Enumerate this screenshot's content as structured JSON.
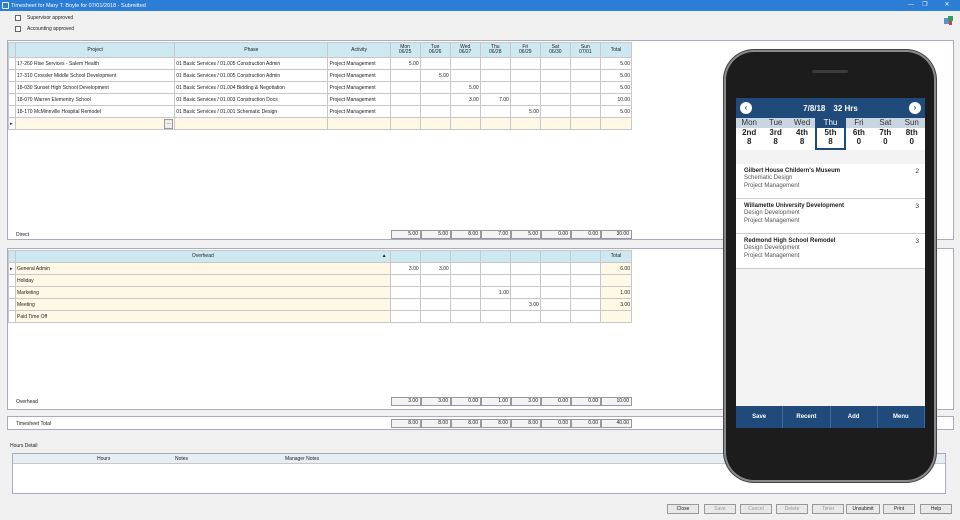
{
  "window": {
    "title": "Timesheet for Mary T. Boyle for 07/01/2018  - Submitted",
    "min": "—",
    "restore": "❐",
    "close": "✕"
  },
  "approvals": {
    "supervisor": "Supervisor approved",
    "accounting": "Accounting approved"
  },
  "direct": {
    "headers": {
      "project": "Project",
      "phase": "Phase",
      "activity": "Activity",
      "total": "Total"
    },
    "days": [
      {
        "name": "Mon",
        "date": "06/25"
      },
      {
        "name": "Tue",
        "date": "06/26"
      },
      {
        "name": "Wed",
        "date": "06/27"
      },
      {
        "name": "Thu",
        "date": "06/28"
      },
      {
        "name": "Fri",
        "date": "06/29"
      },
      {
        "name": "Sat",
        "date": "06/30"
      },
      {
        "name": "Sun",
        "date": "07/01"
      }
    ],
    "rows": [
      {
        "project": "17-260 Rise Services - Salem Health",
        "phase": "01 Basic Services / 01.005 Construction Admin",
        "activity": "Project Management",
        "hours": [
          "5.00",
          "",
          "",
          "",
          "",
          "",
          ""
        ],
        "total": "5.00"
      },
      {
        "project": "17-310 Crossler Middle School Development",
        "phase": "01 Basic Services / 01.005 Construction Admin",
        "activity": "Project Management",
        "hours": [
          "",
          "5.00",
          "",
          "",
          "",
          "",
          ""
        ],
        "total": "5.00"
      },
      {
        "project": "18-030 Sunset High School Development",
        "phase": "01 Basic Services / 01.004 Bidding & Negotiation",
        "activity": "Project Management",
        "hours": [
          "",
          "",
          "5.00",
          "",
          "",
          "",
          ""
        ],
        "total": "5.00"
      },
      {
        "project": "18-070 Warren Elementry School",
        "phase": "01 Basic Services / 01.003 Construction Docs",
        "activity": "Project Management",
        "hours": [
          "",
          "",
          "3.00",
          "7.00",
          "",
          "",
          ""
        ],
        "total": "10.00"
      },
      {
        "project": "18-170 McMinnville Hospital Remodel",
        "phase": "01 Basic Services / 01.001 Schematic Design",
        "activity": "Project Management",
        "hours": [
          "",
          "",
          "",
          "",
          "5.00",
          "",
          ""
        ],
        "total": "5.00"
      }
    ],
    "ellipsis": "···",
    "summary_label": "Direct",
    "summary": [
      "5.00",
      "5.00",
      "8.00",
      "7.00",
      "5.00",
      "0.00",
      "0.00"
    ],
    "summary_total": "30.00"
  },
  "overhead": {
    "header": "Overhead",
    "sort_icon": "▲",
    "total_header": "Total",
    "rows": [
      {
        "name": "General Admin",
        "hours": [
          "3.00",
          "3.00",
          "",
          "",
          "",
          "",
          ""
        ],
        "total": "6.00"
      },
      {
        "name": "Holiday",
        "hours": [
          "",
          "",
          "",
          "",
          "",
          "",
          ""
        ],
        "total": ""
      },
      {
        "name": "Marketing",
        "hours": [
          "",
          "",
          "",
          "1.00",
          "",
          "",
          ""
        ],
        "total": "1.00"
      },
      {
        "name": "Meeting",
        "hours": [
          "",
          "",
          "",
          "",
          "3.00",
          "",
          ""
        ],
        "total": "3.00"
      },
      {
        "name": "Paid Time Off",
        "hours": [
          "",
          "",
          "",
          "",
          "",
          "",
          ""
        ],
        "total": ""
      }
    ],
    "summary_label": "Overhead",
    "summary": [
      "3.00",
      "3.00",
      "0.00",
      "1.00",
      "3.00",
      "0.00",
      "0.00"
    ],
    "summary_total": "10.00"
  },
  "timesheet_total": {
    "label": "Timesheet Total",
    "values": [
      "8.00",
      "8.00",
      "8.00",
      "8.00",
      "8.00",
      "0.00",
      "0.00"
    ],
    "total": "40.00"
  },
  "hours_detail": {
    "title": "Hours Detail",
    "cols": [
      "Hours",
      "Notes",
      "Manager Notes"
    ]
  },
  "buttons": [
    {
      "label": "Close",
      "enabled": true
    },
    {
      "label": "Save",
      "enabled": false
    },
    {
      "label": "Cancel",
      "enabled": false
    },
    {
      "label": "Delete",
      "enabled": false
    },
    {
      "label": "Timer",
      "enabled": false
    },
    {
      "label": "Unsubmit",
      "enabled": true
    },
    {
      "label": "Print",
      "enabled": true
    },
    {
      "label": "Help",
      "enabled": true
    }
  ],
  "phone": {
    "header": {
      "date": "7/8/18",
      "hours": "32 Hrs",
      "prev": "‹",
      "next": "›"
    },
    "days": [
      {
        "name": "Mon",
        "num": "2nd",
        "hrs": "8"
      },
      {
        "name": "Tue",
        "num": "3rd",
        "hrs": "8"
      },
      {
        "name": "Wed",
        "num": "4th",
        "hrs": "8"
      },
      {
        "name": "Thu",
        "num": "5th",
        "hrs": "8"
      },
      {
        "name": "Fri",
        "num": "6th",
        "hrs": "0"
      },
      {
        "name": "Sat",
        "num": "7th",
        "hrs": "0"
      },
      {
        "name": "Sun",
        "num": "8th",
        "hrs": "0"
      }
    ],
    "selected_day": 3,
    "entries": [
      {
        "title": "Gilbert House Childern's Museum",
        "line1": "Schematic Design",
        "line2": "Project Management",
        "hours": "2"
      },
      {
        "title": "Willamette University Development",
        "line1": "Design Development",
        "line2": "Project Management",
        "hours": "3"
      },
      {
        "title": "Redmond High School Remodel",
        "line1": "Design Development",
        "line2": "Project Management",
        "hours": "3"
      }
    ],
    "footer": [
      "Save",
      "Recent",
      "Add",
      "Menu"
    ]
  },
  "colors": {
    "titlebar": "#2b7dd6",
    "grid_header": "#cde8f0",
    "phone_accent": "#1f4a7a",
    "cream": "#fff8e6"
  }
}
